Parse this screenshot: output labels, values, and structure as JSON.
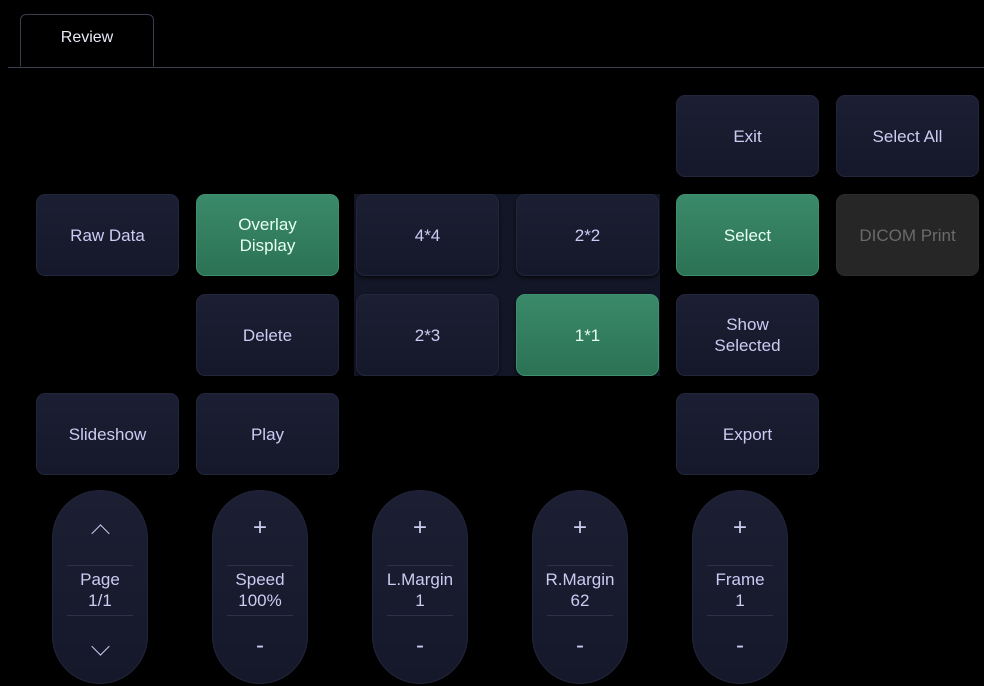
{
  "tabs": [
    {
      "label": "Review"
    }
  ],
  "buttons": {
    "exit": "Exit",
    "select_all": "Select All",
    "raw_data": "Raw Data",
    "overlay_display": "Overlay\nDisplay",
    "layout_4x4": "4*4",
    "layout_2x2": "2*2",
    "select": "Select",
    "dicom_print": "DICOM Print",
    "delete": "Delete",
    "layout_2x3": "2*3",
    "layout_1x1": "1*1",
    "show_selected": "Show\nSelected",
    "slideshow": "Slideshow",
    "play": "Play",
    "export": "Export"
  },
  "knobs": {
    "page": {
      "label": "Page",
      "value": "1/1"
    },
    "speed": {
      "label": "Speed",
      "value": "100%",
      "inc": "+",
      "dec": "-"
    },
    "l_margin": {
      "label": "L.Margin",
      "value": "1",
      "inc": "+",
      "dec": "-"
    },
    "r_margin": {
      "label": "R.Margin",
      "value": "62",
      "inc": "+",
      "dec": "-"
    },
    "frame": {
      "label": "Frame",
      "value": "1",
      "inc": "+",
      "dec": "-"
    }
  },
  "colors": {
    "active": "#2c7255",
    "button": "#1a1d30",
    "disabled": "#262626",
    "text": "#c9cdf2"
  }
}
